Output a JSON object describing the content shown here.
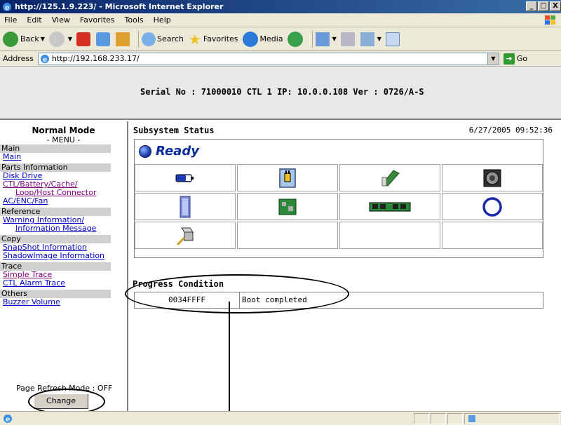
{
  "window": {
    "title": "http://125.1.9.223/ - Microsoft Internet Explorer",
    "min": "_",
    "max": "□",
    "close": "X"
  },
  "menu": {
    "items": [
      "File",
      "Edit",
      "View",
      "Favorites",
      "Tools",
      "Help"
    ]
  },
  "toolbar": {
    "back": "Back",
    "search": "Search",
    "favorites": "Favorites",
    "media": "Media"
  },
  "address": {
    "label": "Address",
    "url": "http://192.168.233.17/",
    "go": "Go"
  },
  "header": {
    "serial": "Serial No : 71000010  CTL 1  IP: 10.0.0.108  Ver : 0726/A-S"
  },
  "sidebar": {
    "title": "Normal Mode",
    "subtitle": "- MENU -",
    "sections": [
      {
        "label": "Main",
        "links": [
          "Main"
        ]
      },
      {
        "label": "Parts Information",
        "links": [
          "Disk Drive",
          "CTL/Battery/Cache/",
          "Loop/Host Connector",
          "AC/ENC/Fan"
        ]
      },
      {
        "label": "Reference",
        "links": [
          "Warning Information/",
          "Information Message"
        ]
      },
      {
        "label": "Copy",
        "links": [
          "SnapShot Information",
          "ShadowImage Information"
        ]
      },
      {
        "label": "Trace",
        "links": [
          "Simple Trace",
          "CTL Alarm Trace"
        ]
      },
      {
        "label": "Others",
        "links": [
          "Buzzer Volume"
        ]
      }
    ],
    "refresh_label": "Page Refresh Mode : OFF",
    "change_button": "Change"
  },
  "main": {
    "status_title": "Subsystem Status",
    "datetime": "6/27/2005 09:52:36",
    "ready": "Ready",
    "components": [
      [
        "battery-icon",
        "power-plug-icon",
        "circuit-board-icon",
        "fan-icon"
      ],
      [
        "drive-enclosure-icon",
        "cache-board-icon",
        "memory-module-icon",
        "loop-cable-icon"
      ],
      [
        "host-connector-icon",
        "",
        "",
        ""
      ]
    ],
    "progress_title": "Progress Condition",
    "progress_code": "0034FFFF",
    "progress_message": "Boot completed"
  },
  "colors": {
    "ready_text": "#0a2a9a",
    "link": "#0000cc",
    "visited_link": "#800080",
    "title_bar": "#0a246a"
  }
}
